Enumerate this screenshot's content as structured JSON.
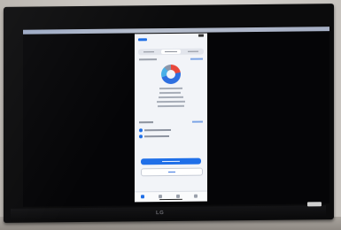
{
  "scene": {
    "description_level": "photo",
    "tv_brand": "LG"
  },
  "colors": {
    "accent": "#1f6fe8",
    "danger": "#e8483c",
    "phone_background": "#f2f4f8",
    "tv_bezel": "#0b0b0c"
  },
  "phone": {
    "donut_segments": [
      {
        "color": "#e8483c",
        "share": 0.22
      },
      {
        "color": "#2e6fe0",
        "share": 0.48
      },
      {
        "color": "#49b0e8",
        "share": 0.18
      },
      {
        "color": "#8a96aa",
        "share": 0.12
      }
    ],
    "selected_tab_index": 1,
    "active_tabbar_index": 0
  }
}
